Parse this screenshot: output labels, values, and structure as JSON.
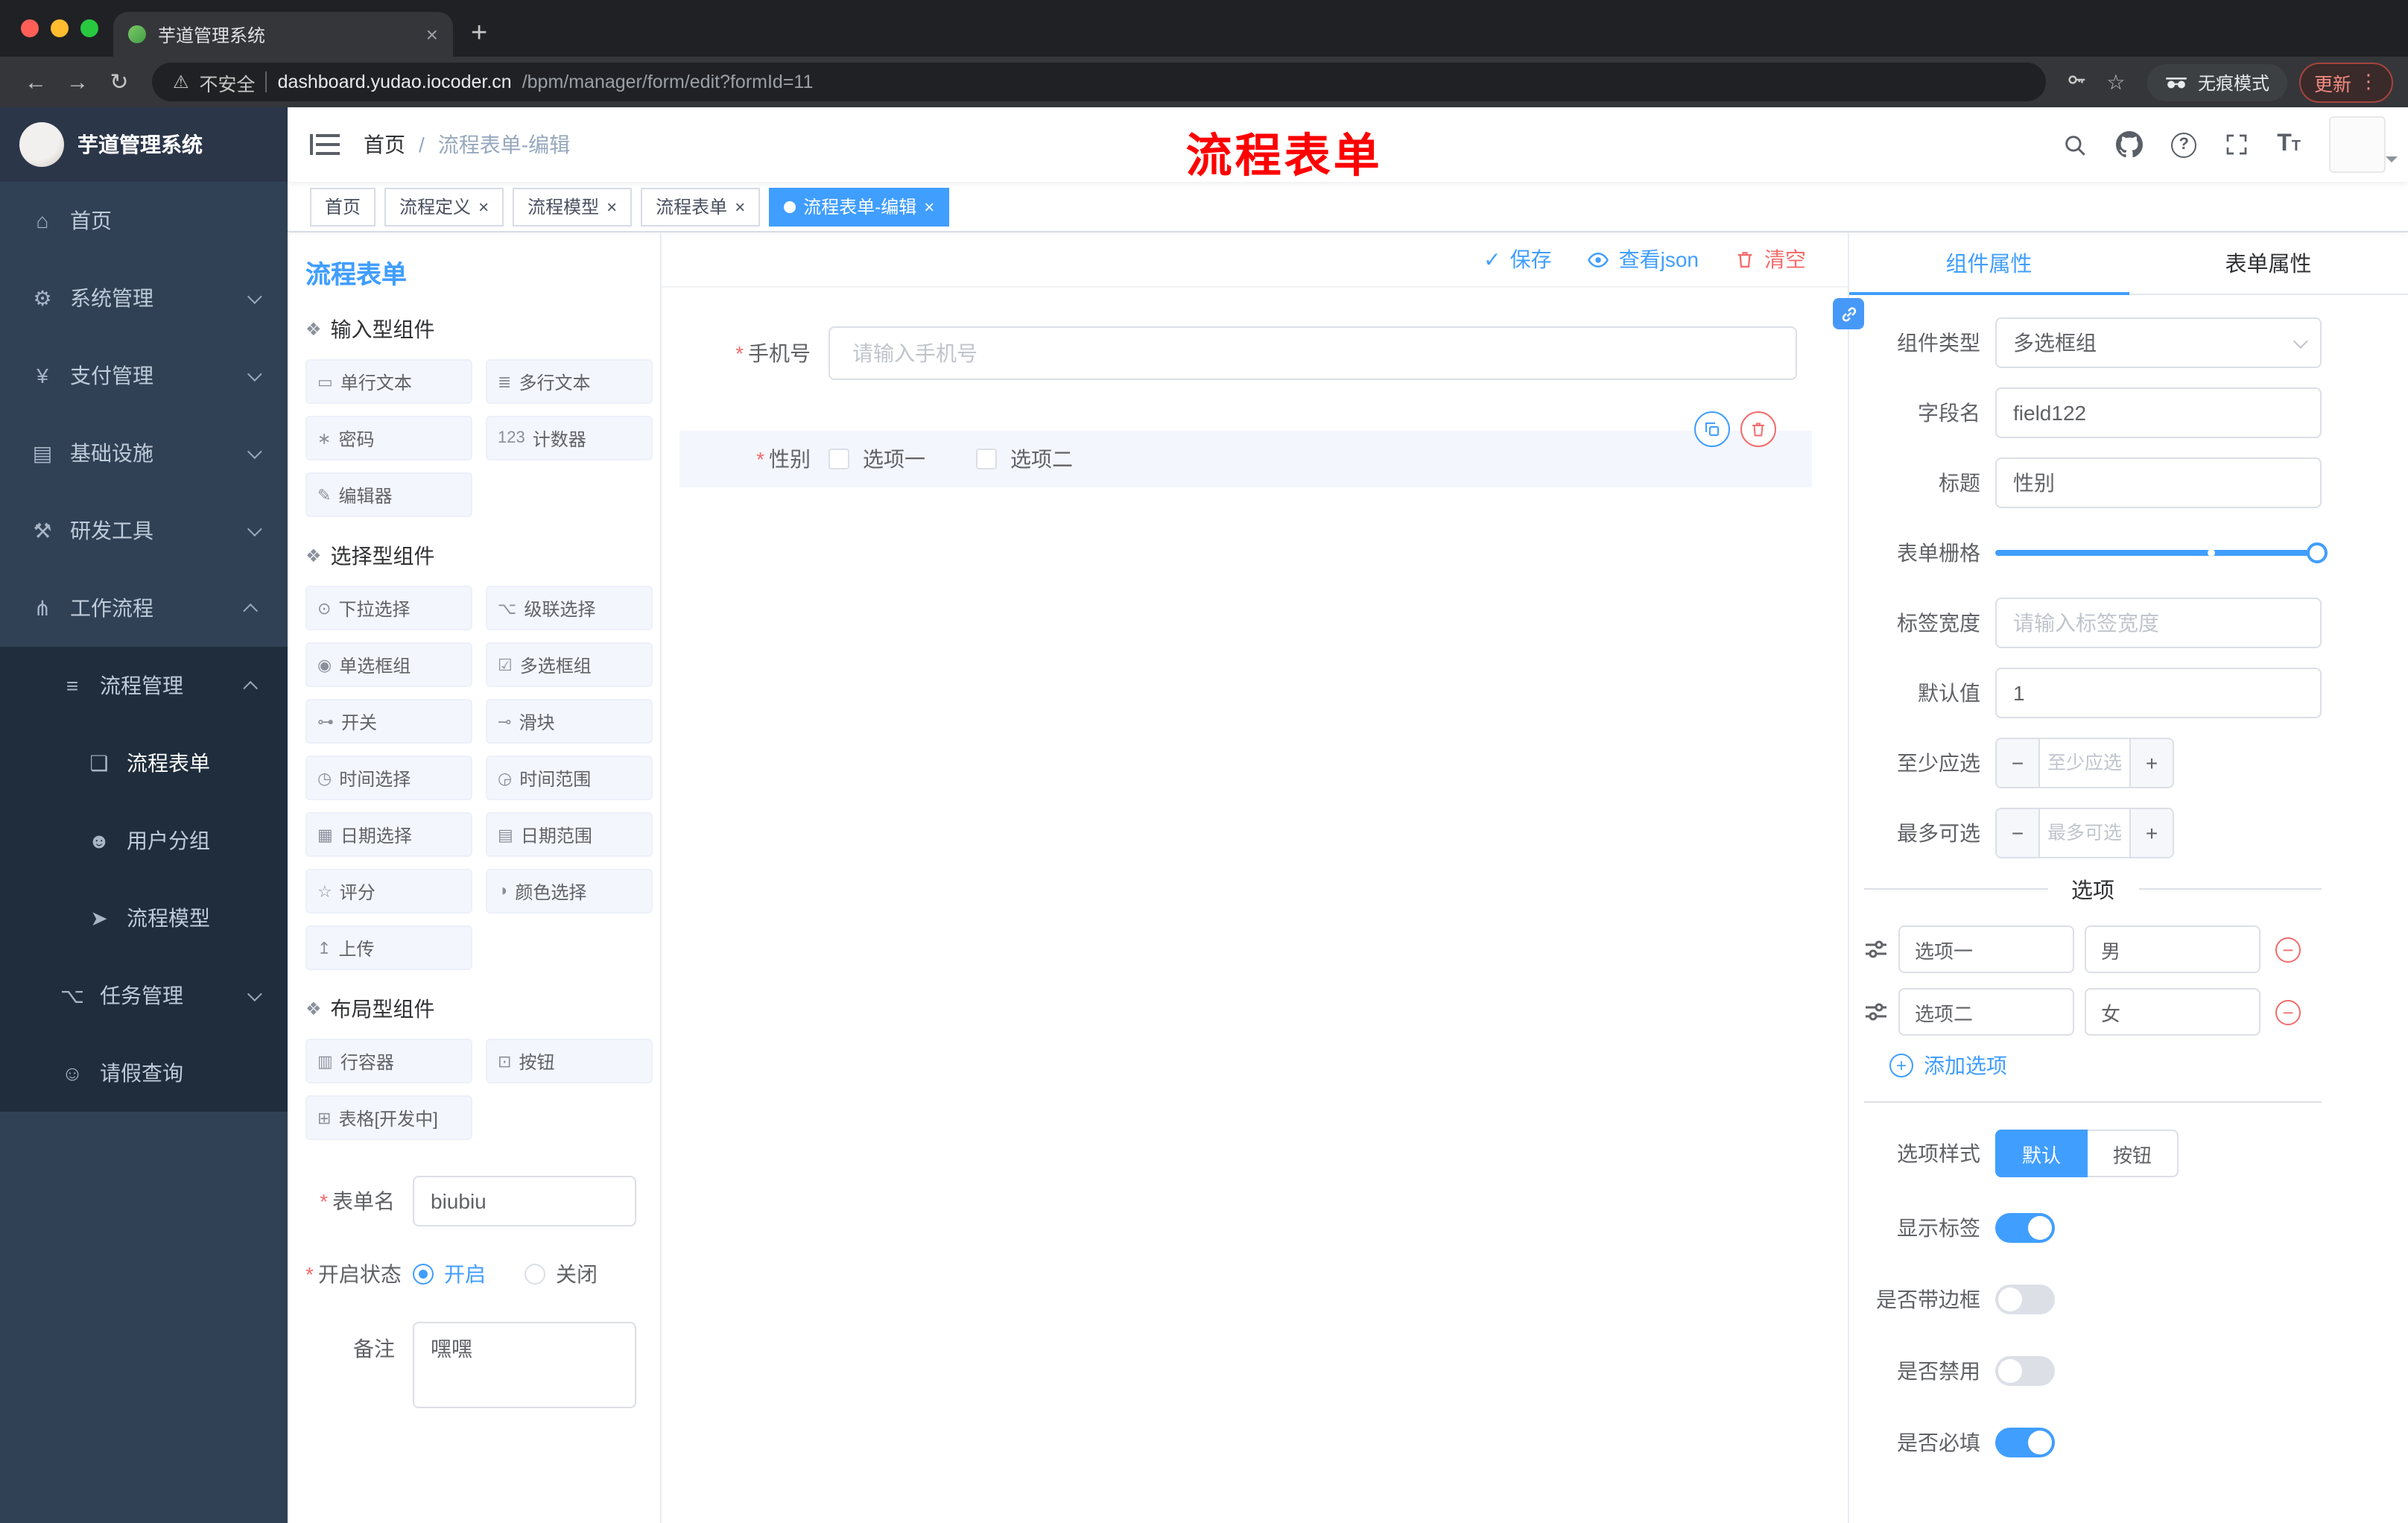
{
  "colors": {
    "accent": "#409eff",
    "danger": "#f56c6c",
    "annotation_red": "#fe0000",
    "sidebar_bg": "#304156",
    "submenu_bg": "#1f2d3d",
    "active_tag_bg": "#409eff"
  },
  "icons": {
    "close": "×",
    "plus": "+",
    "minus": "−",
    "back": "←",
    "forward": "→",
    "reload": "↻",
    "warning": "⚠",
    "star": "☆",
    "menu_dots": "⋮",
    "question": "?",
    "check": "✓",
    "section": "❖",
    "text_size_big": "T",
    "text_size_small": "T"
  },
  "browser": {
    "tab_title": "芋道管理系统",
    "security_label": "不安全",
    "url_host": "dashboard.yudao.iocoder.cn",
    "url_path": "/bpm/manager/form/edit?formId=11",
    "incognito_label": "无痕模式",
    "update_label": "更新"
  },
  "sidebar": {
    "logo_title": "芋道管理系统",
    "items": [
      {
        "label": "首页",
        "glyph": "⌂",
        "icon": "home-icon",
        "level": 1
      },
      {
        "label": "系统管理",
        "glyph": "⚙",
        "icon": "system-management-icon",
        "level": 1,
        "arrow": "down"
      },
      {
        "label": "支付管理",
        "glyph": "¥",
        "icon": "payment-management-icon",
        "level": 1,
        "arrow": "down"
      },
      {
        "label": "基础设施",
        "glyph": "▤",
        "icon": "infrastructure-icon",
        "level": 1,
        "arrow": "down"
      },
      {
        "label": "研发工具",
        "glyph": "⚒",
        "icon": "dev-tools-icon",
        "level": 1,
        "arrow": "down"
      },
      {
        "label": "工作流程",
        "glyph": "⋔",
        "icon": "workflow-icon",
        "level": 1,
        "arrow": "up"
      },
      {
        "label": "流程管理",
        "glyph": "≡",
        "icon": "process-management-icon",
        "level": 2,
        "arrow": "up"
      },
      {
        "label": "流程表单",
        "glyph": "❏",
        "icon": "process-form-icon",
        "level": 3,
        "active": true
      },
      {
        "label": "用户分组",
        "glyph": "☻",
        "icon": "user-group-icon",
        "level": 3
      },
      {
        "label": "流程模型",
        "glyph": "➤",
        "icon": "process-model-icon",
        "level": 3
      },
      {
        "label": "任务管理",
        "glyph": "⌥",
        "icon": "task-management-icon",
        "level": 2,
        "arrow": "down"
      },
      {
        "label": "请假查询",
        "glyph": "☺",
        "icon": "leave-query-icon",
        "level": 2
      }
    ]
  },
  "header": {
    "breadcrumb_home": "首页",
    "breadcrumb_sep": "/",
    "breadcrumb_current": "流程表单-编辑",
    "annotation": "流程表单"
  },
  "tags": [
    {
      "label": "首页"
    },
    {
      "label": "流程定义",
      "closable": true
    },
    {
      "label": "流程模型",
      "closable": true
    },
    {
      "label": "流程表单",
      "closable": true
    },
    {
      "label": "流程表单-编辑",
      "closable": true,
      "active": true
    }
  ],
  "designer": {
    "title": "流程表单",
    "toolbar": {
      "save": "保存",
      "view_json": "查看json",
      "clear": "清空"
    },
    "palette": {
      "inputs": {
        "title": "输入型组件",
        "items": [
          {
            "label": "单行文本",
            "glyph": "▭",
            "icon": "single-line-text-icon"
          },
          {
            "label": "多行文本",
            "glyph": "≣",
            "icon": "multi-line-text-icon"
          },
          {
            "label": "密码",
            "glyph": "∗",
            "icon": "password-icon"
          },
          {
            "label": "计数器",
            "glyph": "123",
            "icon": "counter-icon"
          },
          {
            "label": "编辑器",
            "glyph": "✎",
            "icon": "editor-icon"
          }
        ]
      },
      "selects": {
        "title": "选择型组件",
        "items": [
          {
            "label": "下拉选择",
            "glyph": "⊙",
            "icon": "dropdown-select-icon"
          },
          {
            "label": "级联选择",
            "glyph": "⌥",
            "icon": "cascader-icon"
          },
          {
            "label": "单选框组",
            "glyph": "◉",
            "icon": "radio-group-icon"
          },
          {
            "label": "多选框组",
            "glyph": "☑",
            "icon": "checkbox-group-icon"
          },
          {
            "label": "开关",
            "glyph": "⊶",
            "icon": "switch-component-icon"
          },
          {
            "label": "滑块",
            "glyph": "⊸",
            "icon": "slider-component-icon"
          },
          {
            "label": "时间选择",
            "glyph": "◷",
            "icon": "time-picker-icon"
          },
          {
            "label": "时间范围",
            "glyph": "◶",
            "icon": "time-range-icon"
          },
          {
            "label": "日期选择",
            "glyph": "▦",
            "icon": "date-picker-icon"
          },
          {
            "label": "日期范围",
            "glyph": "▤",
            "icon": "date-range-icon"
          },
          {
            "label": "评分",
            "glyph": "☆",
            "icon": "rate-icon"
          },
          {
            "label": "颜色选择",
            "glyph": "◑",
            "icon": "color-picker-icon"
          },
          {
            "label": "上传",
            "glyph": "↥",
            "icon": "upload-icon"
          }
        ]
      },
      "layouts": {
        "title": "布局型组件",
        "items": [
          {
            "label": "行容器",
            "glyph": "▥",
            "icon": "row-container-icon"
          },
          {
            "label": "按钮",
            "glyph": "⊡",
            "icon": "button-component-icon"
          },
          {
            "label": "表格[开发中]",
            "glyph": "⊞",
            "icon": "table-component-icon"
          }
        ]
      }
    },
    "form": {
      "name_label": "表单名",
      "name_value": "biubiu",
      "status_label": "开启状态",
      "status_on": "开启",
      "status_off": "关闭",
      "remark_label": "备注",
      "remark_value": "嘿嘿"
    },
    "canvas": {
      "phone_label": "手机号",
      "phone_placeholder": "请输入手机号",
      "gender_label": "性别",
      "gender_option1": "选项一",
      "gender_option2": "选项二"
    }
  },
  "props": {
    "tab_component": "组件属性",
    "tab_form": "表单属性",
    "component_type_label": "组件类型",
    "component_type_value": "多选框组",
    "field_name_label": "字段名",
    "field_name_value": "field122",
    "title_label": "标题",
    "title_value": "性别",
    "grid_label": "表单栅格",
    "label_width_label": "标签宽度",
    "label_width_placeholder": "请输入标签宽度",
    "default_label": "默认值",
    "default_value": "1",
    "min_label": "至少应选",
    "min_placeholder": "至少应选",
    "max_label": "最多可选",
    "max_placeholder": "最多可选",
    "options_title": "选项",
    "options": [
      {
        "label": "选项一",
        "value": "男"
      },
      {
        "label": "选项二",
        "value": "女"
      }
    ],
    "add_option": "添加选项",
    "style_label": "选项样式",
    "style_default": "默认",
    "style_button": "按钮",
    "switches": [
      {
        "label": "显示标签",
        "on": true
      },
      {
        "label": "是否带边框",
        "on": false
      },
      {
        "label": "是否禁用",
        "on": false
      },
      {
        "label": "是否必填",
        "on": true
      }
    ]
  }
}
